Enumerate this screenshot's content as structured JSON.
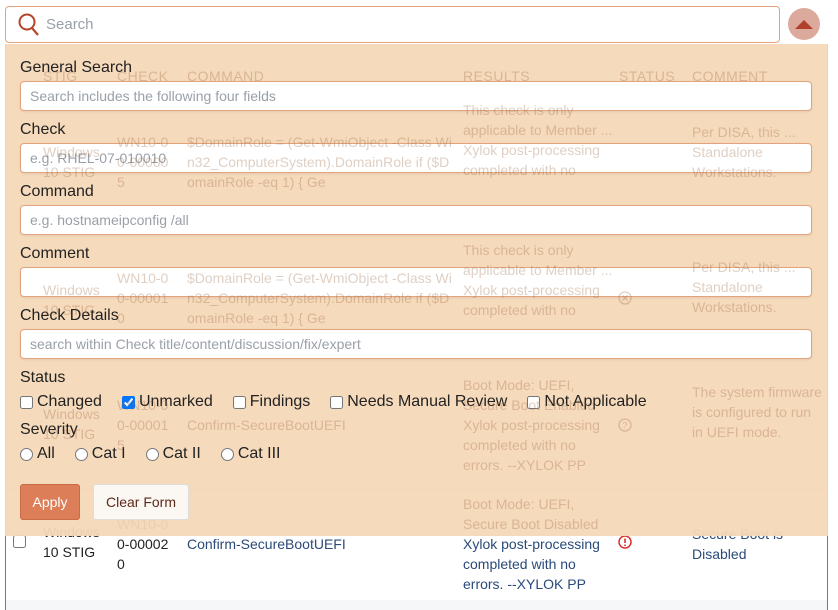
{
  "search": {
    "placeholder": "Search",
    "icon": "search-icon"
  },
  "toggle": {
    "icon": "caret-up-icon"
  },
  "table": {
    "headers": [
      "STIG",
      "CHECK",
      "COMMAND",
      "RESULTS",
      "STATUS",
      "COMMENT"
    ],
    "rows": [
      {
        "stig": "Windows 10 STIG",
        "check": "WN10-00-000005",
        "command": "$DomainRole = (Get-WmiObject -Class Win32_ComputerSystem).DomainRole if ($DomainRole -eq 1) { Ge",
        "results": "This check is only applicable to Member ... Xylok post-processing completed with no",
        "comment": "Per DISA, this ... Standalone Workstations."
      },
      {
        "stig": "Windows 10 STIG",
        "check": "WN10-00-000010",
        "command": "$DomainRole = (Get-WmiObject -Class Win32_ComputerSystem).DomainRole if ($DomainRole -eq 1) { Ge",
        "results": "This check is only applicable to Member ... Xylok post-processing completed with no",
        "comment": "Per DISA, this ... Standalone Workstations."
      },
      {
        "stig": "Windows 10 STIG",
        "check": "WN10-00-000015",
        "command": "Confirm-SecureBootUEFI",
        "results": "Boot Mode: UEFI, Secure Boot Enabled Xylok post-processing completed with no errors. --XYLOK PP",
        "comment": "The system firmware is configured to run in UEFI mode."
      },
      {
        "stig": "Windows 10 STIG",
        "check": "WN10-00-000020",
        "command": "Confirm-SecureBootUEFI",
        "results_pre": "Boot Mode: UEFI, Secure Boot Disabled",
        "results": "Xylok post-processing completed with no errors. --XYLOK PP",
        "comment": "Secure Boot is Disabled",
        "status_color": "#d9302c"
      }
    ]
  },
  "form": {
    "general_label": "General Search",
    "general_placeholder": "Search includes the following four fields",
    "check_label": "Check",
    "check_placeholder": "e.g. RHEL-07-010010",
    "command_label": "Command",
    "command_placeholder": "e.g. hostnameipconfig /all",
    "comment_label": "Comment",
    "comment_placeholder": "",
    "details_label": "Check Details",
    "details_placeholder": "search within Check title/content/discussion/fix/expert",
    "status_label": "Status",
    "status_options": [
      {
        "label": "Changed",
        "checked": false
      },
      {
        "label": "Unmarked",
        "checked": true
      },
      {
        "label": "Findings",
        "checked": false
      },
      {
        "label": "Needs Manual Review",
        "checked": false
      },
      {
        "label": "Not Applicable",
        "checked": false
      }
    ],
    "severity_label": "Severity",
    "severity_options": [
      "All",
      "Cat I",
      "Cat II",
      "Cat III"
    ],
    "apply": "Apply",
    "clear": "Clear Form"
  }
}
